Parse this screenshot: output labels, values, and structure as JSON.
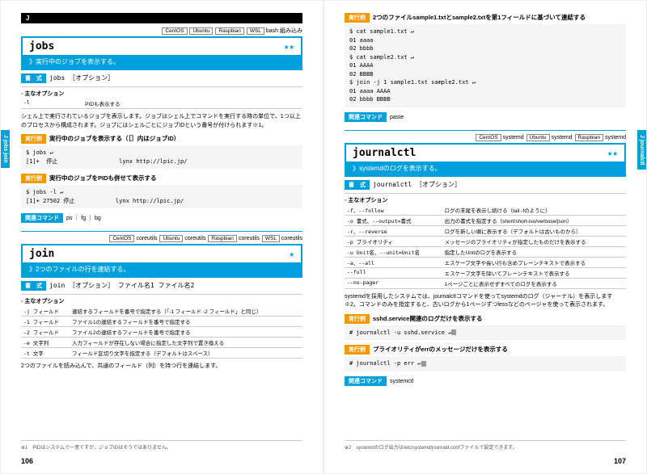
{
  "letterHead": "J",
  "sideLeft": "J   jobs   join",
  "sideRight": "J   journalctl",
  "pageLeft": "106",
  "pageRight": "107",
  "jobs": {
    "tags": [
      "CentOS",
      "Ubuntu",
      "Raspbian",
      "WSL"
    ],
    "tagSuffix": "bash 組み込み",
    "name": "jobs",
    "stars": "★★",
    "desc": "》実行中のジョブを表示する。",
    "syntaxLabel": "書　式",
    "syntax": "jobs ［オプション］",
    "optHead": "◦ 主なオプション",
    "opt1a": "-l",
    "opt1b": "PIDも表示する",
    "body": "シェル上で実行されているジョブを表示します。ジョブはシェル上でコマンドを実行する時の単位で、1つ以上のプロセスから構成されます。ジョブにはシェルごとにジョブIDという番号が付けられます※1。",
    "ex1Label": "実行例",
    "ex1Title": "実行中のジョブを表示する（［］内はジョブID）",
    "ex1": "$ jobs ↵\n[1]+  停止                  lynx http://lpic.jp/",
    "ex2Title": "実行中のジョブをPIDも併せて表示する",
    "ex2": "$ jobs -l ↵\n[1]+ 27502 停止            lynx http://lpic.jp/",
    "relLabel": "関連コマンド",
    "rel": "ps ｜ fg ｜ bg",
    "foot": "※1　PIDはシステムで一意ですが、ジョブIDはそうではありません。"
  },
  "join": {
    "tags": [
      "CentOS",
      "Ubuntu",
      "Raspbian",
      "WSL"
    ],
    "tagSuffix": "coreutils",
    "name": "join",
    "stars": "★",
    "desc": "》2つのファイルの行を連結する。",
    "syntax": "join ［オプション］ ファイル名1 ファイル名2",
    "optHead": "◦ 主なオプション",
    "o1a": "-j フィールド",
    "o1b": "連結するフィールドを番号で指定する（「-1 フィールド -2 フィールド」と同じ）",
    "o2a": "-1 フィールド",
    "o2b": "ファイル1の連結するフィールドを番号で指定する",
    "o3a": "-2 フィールド",
    "o3b": "ファイル2の連結するフィールドを番号で指定する",
    "o4a": "-e 文字列",
    "o4b": "入力フィールドが存在しない場合に指定した文字列で置き換える",
    "o5a": "-t 文字",
    "o5b": "フィールド区切り文字を指定する（デフォルトはスペース）",
    "body": "2つのファイルを読み込んで、共通のフィールド（列）を持つ行を連結します。",
    "exTitle": "2つのファイルsample1.txtとsample2.txtを第1フィールドに基づいて連結する",
    "ex": "$ cat sample1.txt ↵\n01 aaaa\n02 bbbb\n$ cat sample2.txt ↵\n01 AAAA\n02 BBBB\n$ join -j 1 sample1.txt sample2.txt ↵\n01 aaaa AAAA\n02 bbbb BBBB",
    "rel": "paste"
  },
  "journalctl": {
    "tags": [
      "CentOS",
      "Ubuntu",
      "Raspbian"
    ],
    "tagSuffix": "systemd",
    "name": "journalctl",
    "stars": "★★",
    "desc": "》systemdのログを表示する。",
    "syntax": "journalctl ［オプション］",
    "optHead": "◦ 主なオプション",
    "o1a": "-f、--follow",
    "o1b": "ログの末尾を表示し続ける（tail -fのように）",
    "o2a": "-o 書式、--output=書式",
    "o2b": "出力の書式を指定する（short/short-iso/verbose/json）",
    "o3a": "-r、--reverse",
    "o3b": "ログを新しい順に表示する（デフォルトは古いものから）",
    "o4a": "-p プライオリティ",
    "o4b": "メッセージのプライオリティが指定したものだけを表示する",
    "o5a": "-u Unit名、--unit=Unit名",
    "o5b": "指定したUnitのログを表示する",
    "o6a": "-a、--all",
    "o6b": "エスケープ文字や長い行も含めプレーンテキストで表示する",
    "o7a": "--full",
    "o7b": "エスケープ文字を除いてプレーンテキストで表示する",
    "o8a": "--no-pager",
    "o8b": "1ページごとに表示せずすべてのログを表示する",
    "body": "systemdを採用したシステムでは、journalctlコマンドを使ってsystemdのログ（ジャーナル）を表示します※2。コマンドのみを指定すると、古いログから1ページずつlessなどのページャを使って表示されます。",
    "ex1Title": "sshd.service関連のログだけを表示する",
    "ex1": "# journalctl -u sshd.service ↵",
    "ex2Title": "プライオリティがerrのメッセージだけを表示する",
    "ex2": "# journalctl -p err ↵",
    "rel": "systemctl",
    "foot": "※2　systemdのログ出力は/etc/systemd/journald.confファイルで設定できます。"
  }
}
